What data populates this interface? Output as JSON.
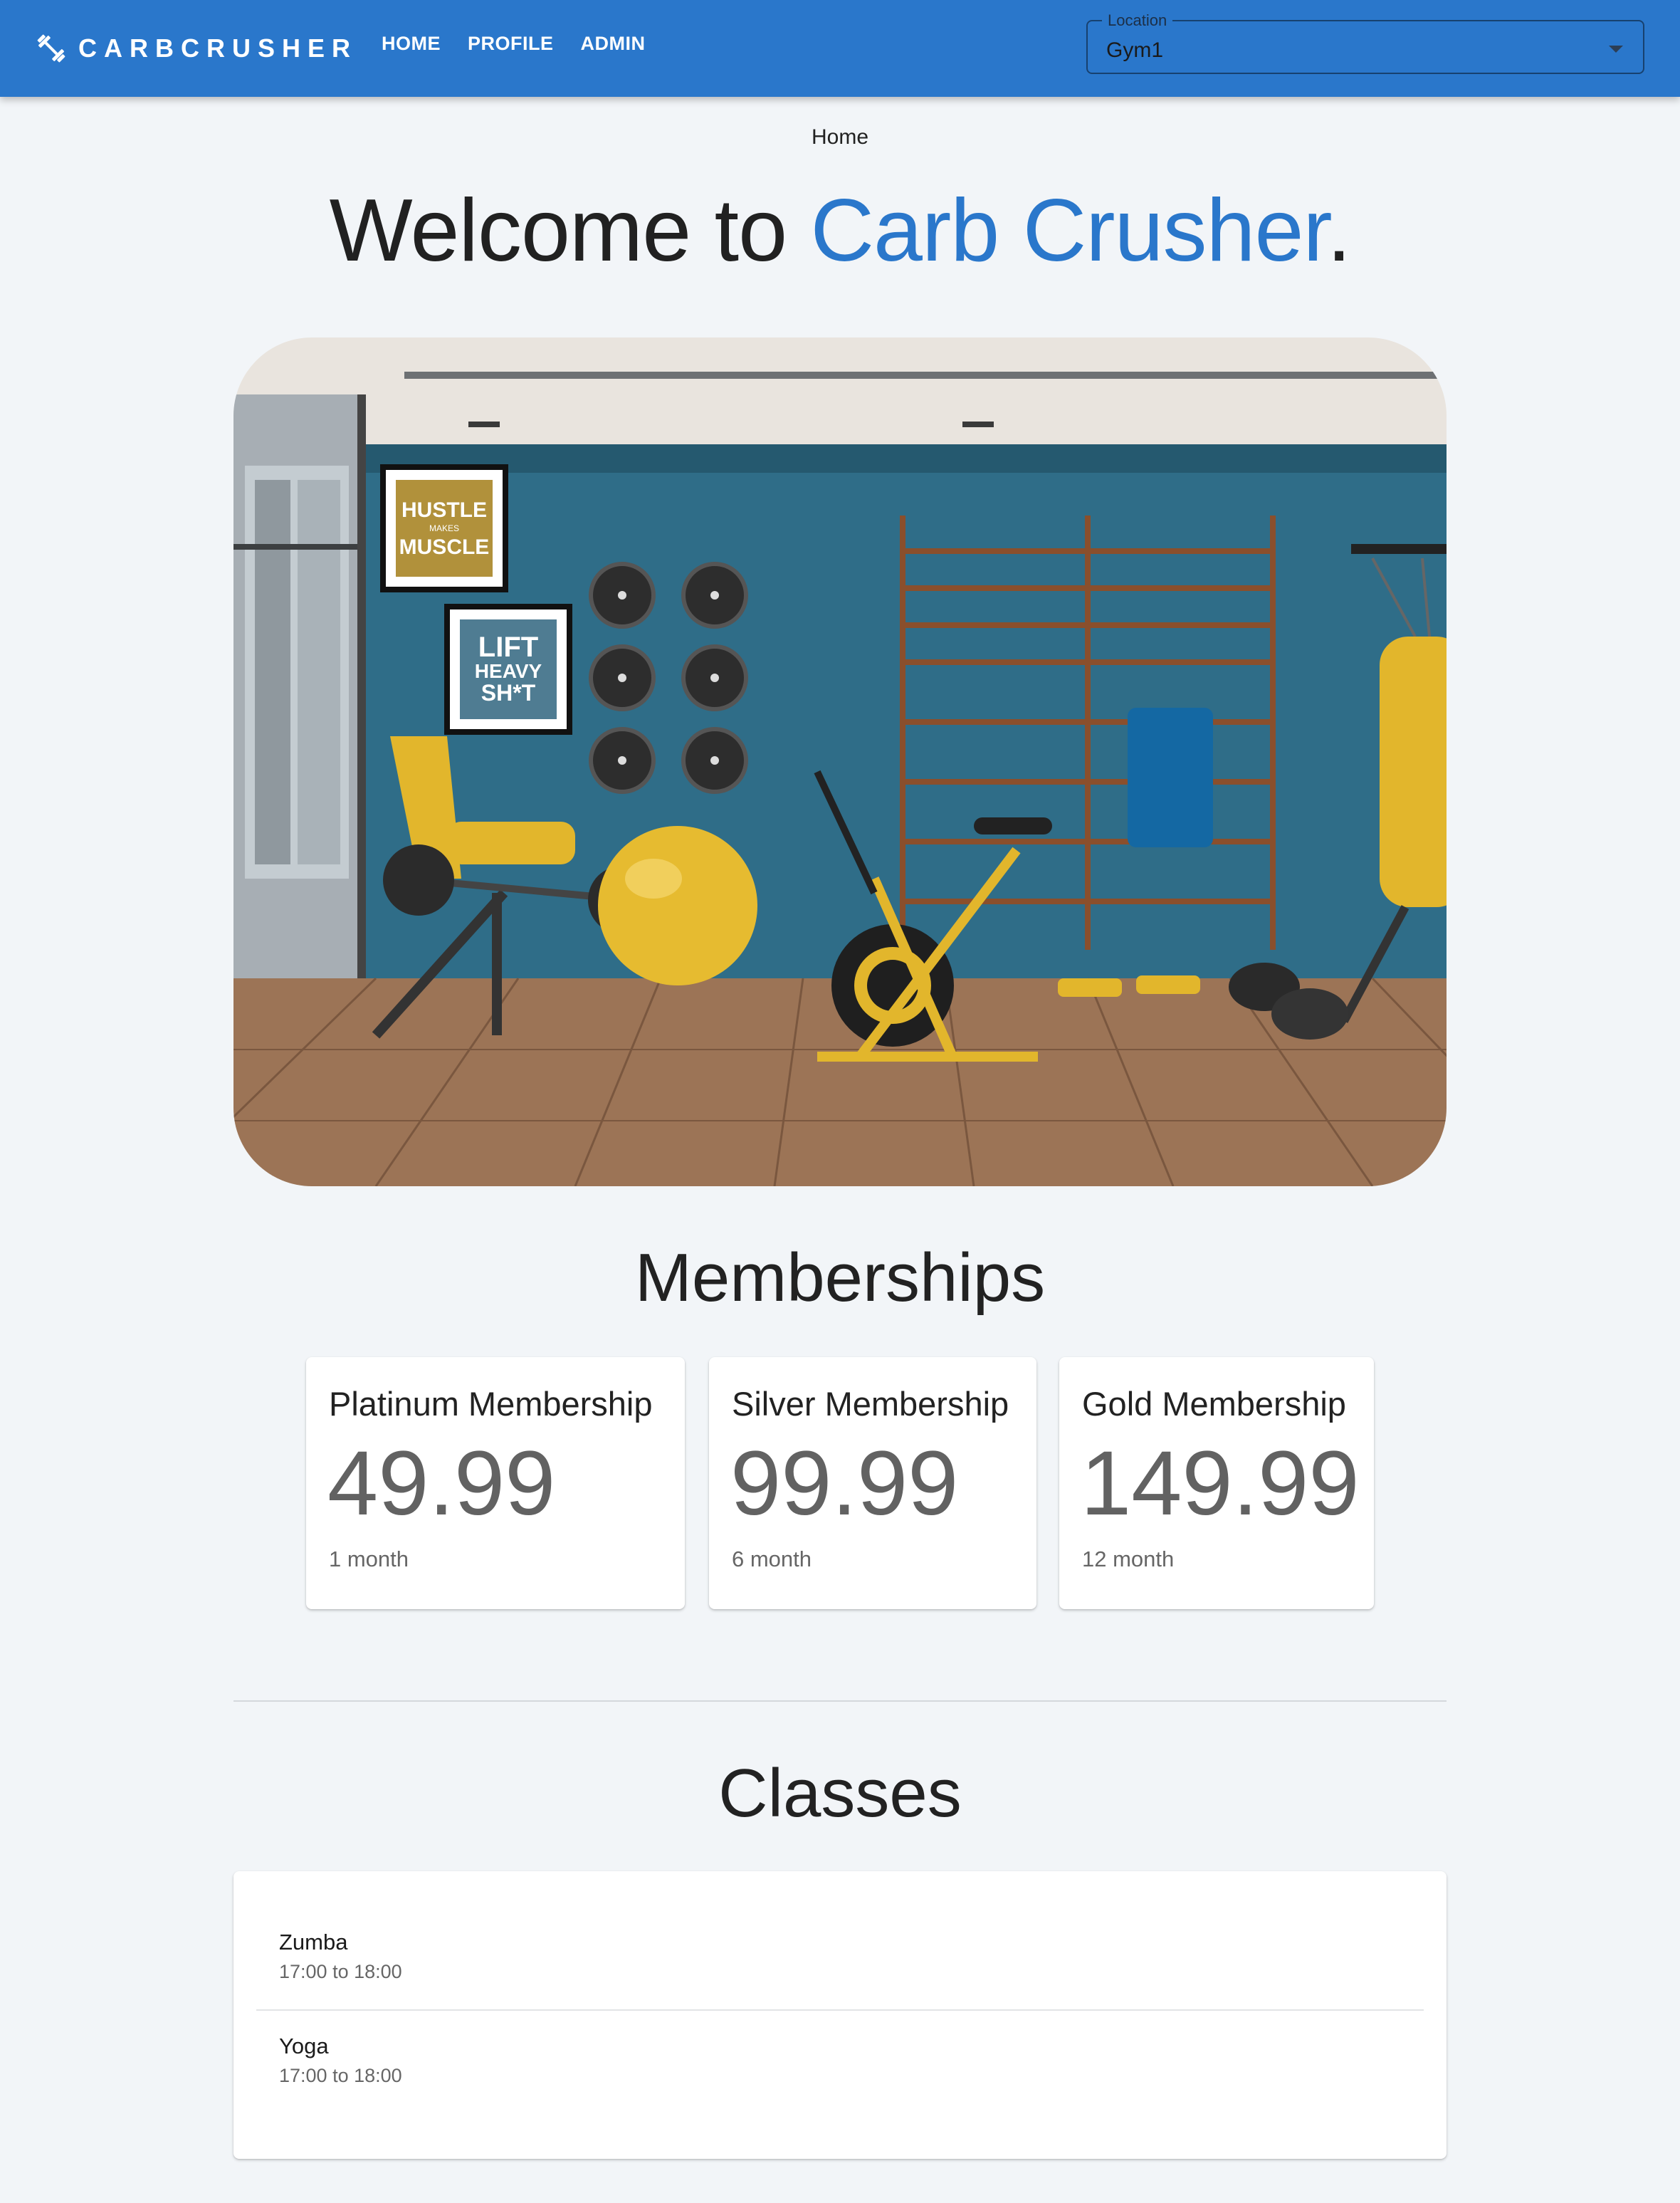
{
  "header": {
    "brand": "CARBCRUSHER",
    "brand_icon": "dumbbell-icon",
    "nav": [
      {
        "label": "HOME"
      },
      {
        "label": "PROFILE"
      },
      {
        "label": "ADMIN"
      }
    ],
    "location": {
      "label": "Location",
      "value": "Gym1"
    }
  },
  "breadcrumb": "Home",
  "hero": {
    "title_prefix": "Welcome to ",
    "title_accent": "Carb Crusher",
    "title_suffix": "."
  },
  "gym_image": {
    "posters": [
      {
        "lines": [
          "HUSTLE",
          "MAKES",
          "MUSCLE"
        ]
      },
      {
        "lines": [
          "LIFT",
          "HEAVY",
          "SH*T"
        ]
      }
    ]
  },
  "memberships": {
    "title": "Memberships",
    "items": [
      {
        "name": "Platinum Membership",
        "price": "49.99",
        "duration": "1 month"
      },
      {
        "name": "Silver Membership",
        "price": "99.99",
        "duration": "6 month"
      },
      {
        "name": "Gold Membership",
        "price": "149.99",
        "duration": "12 month"
      }
    ]
  },
  "classes": {
    "title": "Classes",
    "items": [
      {
        "name": "Zumba",
        "time": "17:00 to 18:00"
      },
      {
        "name": "Yoga",
        "time": "17:00 to 18:00"
      }
    ]
  },
  "colors": {
    "primary": "#2a77cb",
    "background": "#f2f5f8",
    "accent_yellow": "#e2b62c",
    "wall_blue": "#2f6d88"
  }
}
